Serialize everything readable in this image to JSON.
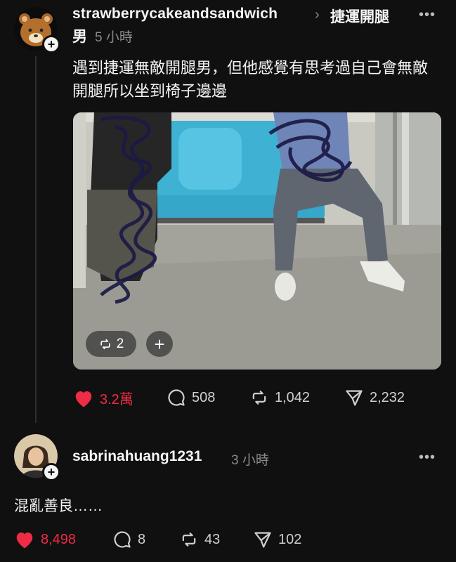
{
  "post": {
    "username": "strawberrycakeandsandwich",
    "topic_chevron": "›",
    "topic_line1": "捷運開腿",
    "topic_line2": "男",
    "time": "5 小時",
    "more": "•••",
    "text": "遇到捷運無敵開腿男，但他感覺有思考過自己會無敵開腿所以坐到椅子邊邊",
    "image_overlay": {
      "repost_count": "2",
      "plus": "+"
    },
    "actions": {
      "likes": "3.2萬",
      "replies": "508",
      "reposts": "1,042",
      "shares": "2,232"
    },
    "like_color": "#ef2b45"
  },
  "reply": {
    "username": "sabrinahuang1231",
    "time": "3 小時",
    "more": "•••",
    "text": "混亂善良……",
    "actions": {
      "likes": "8,498",
      "replies": "8",
      "reposts": "43",
      "shares": "102"
    }
  },
  "follow_plus": "+"
}
